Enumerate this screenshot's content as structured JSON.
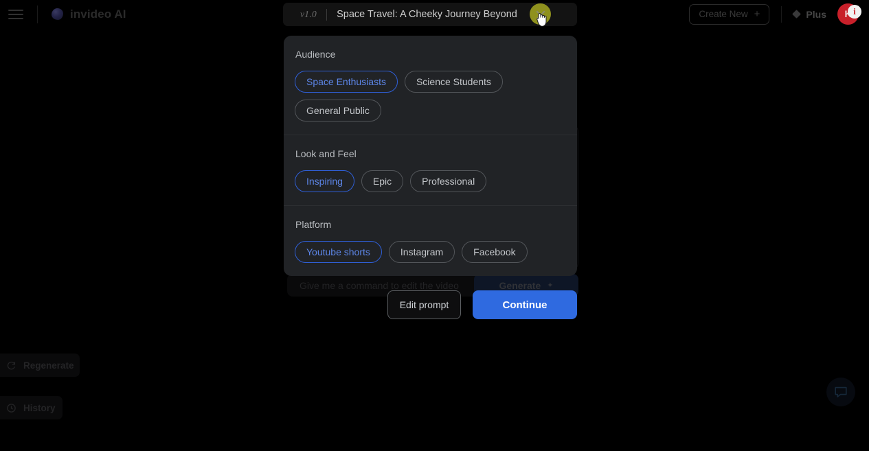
{
  "header": {
    "menu_icon": "hamburger-menu-icon",
    "brand_name": "invideo AI",
    "brand_logo_icon": "invideo-logo-icon",
    "project": {
      "version": "v1.0",
      "title": "Space Travel: A Cheeky Journey Beyond",
      "close_icon": "close-icon"
    },
    "create_new_label": "Create New",
    "create_new_plus": "+",
    "plan_label": "Plus",
    "plan_icon": "diamond-icon",
    "avatar_initial": "K",
    "avatar_badge": "i",
    "accent_avatar_color": "#c8202a",
    "cursor_highlight_color": "#9a9c20"
  },
  "background": {
    "command_placeholder": "Give me a command to edit the video",
    "generate_label": "Generate",
    "generate_icon": "sparkle-icon",
    "rail": [
      {
        "label": "Regenerate",
        "icon": "regenerate-icon"
      },
      {
        "label": "History",
        "icon": "clock-icon"
      }
    ],
    "chat_icon": "chat-bubble-icon"
  },
  "modal": {
    "sections": [
      {
        "title": "Audience",
        "options": [
          {
            "label": "Space Enthusiasts",
            "selected": true
          },
          {
            "label": "Science Students",
            "selected": false
          },
          {
            "label": "General Public",
            "selected": false
          }
        ]
      },
      {
        "title": "Look and Feel",
        "options": [
          {
            "label": "Inspiring",
            "selected": true
          },
          {
            "label": "Epic",
            "selected": false
          },
          {
            "label": "Professional",
            "selected": false
          }
        ]
      },
      {
        "title": "Platform",
        "options": [
          {
            "label": "Youtube shorts",
            "selected": true
          },
          {
            "label": "Instagram",
            "selected": false
          },
          {
            "label": "Facebook",
            "selected": false
          }
        ]
      }
    ],
    "actions": {
      "edit_prompt_label": "Edit prompt",
      "continue_label": "Continue",
      "continue_color": "#2f6ae0"
    },
    "selected_pill_color": "#2f5fd8"
  }
}
